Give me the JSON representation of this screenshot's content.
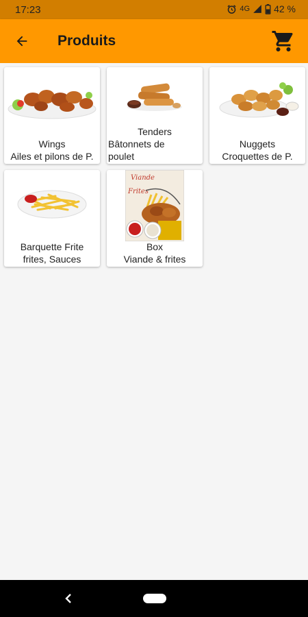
{
  "status": {
    "time": "17:23",
    "network": "4G",
    "battery": "42 %"
  },
  "appbar": {
    "title": "Produits",
    "back_icon": "arrow-back-icon",
    "cart_icon": "shopping-cart-icon"
  },
  "products": [
    {
      "name": "Wings",
      "subtitle": "Ailes et pilons de P."
    },
    {
      "name": "Tenders",
      "subtitle": "Bâtonnets de",
      "subtitle2": "poulet"
    },
    {
      "name": "Nuggets",
      "subtitle": "Croquettes de P."
    },
    {
      "name": "Barquette Frite",
      "subtitle": "frites, Sauces"
    },
    {
      "name": "Box",
      "subtitle": "Viande & frites",
      "image_text": [
        "Viande",
        "Frites"
      ]
    }
  ],
  "colors": {
    "status_bar": "#d27e00",
    "app_bar": "#ff9800",
    "background": "#f5f5f5"
  }
}
